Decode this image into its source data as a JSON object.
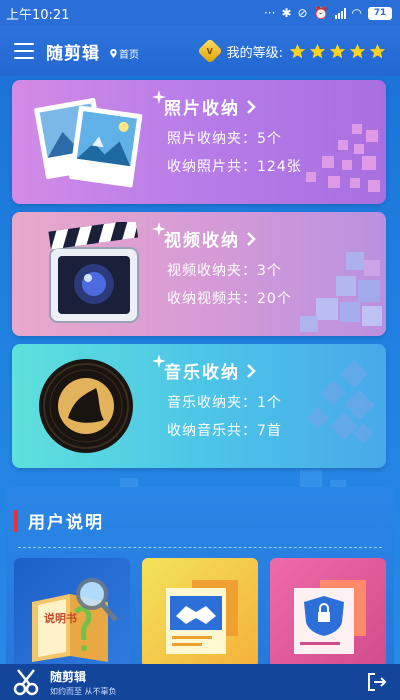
{
  "status_bar": {
    "time": "上午10:21",
    "battery": "71"
  },
  "header": {
    "app_title": "随剪辑",
    "home_label": "首页",
    "level_label": "我的等级:",
    "level_stars": 5
  },
  "cards": {
    "photos": {
      "title": "照片收纳",
      "line1": "照片收纳夹：5个",
      "line2": "收纳照片共：124张"
    },
    "videos": {
      "title": "视频收纳",
      "line1": "视频收纳夹：3个",
      "line2": "收纳视频共：20个"
    },
    "music": {
      "title": "音乐收纳",
      "line1": "音乐收纳夹：1个",
      "line2": "收纳音乐共：7首"
    }
  },
  "guide": {
    "title": "用户说明",
    "manual_book_text": "说明书"
  },
  "footer": {
    "app_name": "随剪辑",
    "slogan": "如约而至 从不辜负"
  },
  "colors": {
    "accent_red": "#e8323a",
    "star_yellow": "#ffd21f",
    "footer_bg": "#13459a"
  },
  "icons": [
    "menu-icon",
    "location-pin-icon",
    "level-badge-icon",
    "star-icon",
    "chevron-right-icon",
    "photo-album-icon",
    "clapperboard-icon",
    "vinyl-record-icon",
    "manual-book-icon",
    "handshake-doc-icon",
    "shield-lock-doc-icon",
    "scissors-logo-icon",
    "logout-icon"
  ]
}
